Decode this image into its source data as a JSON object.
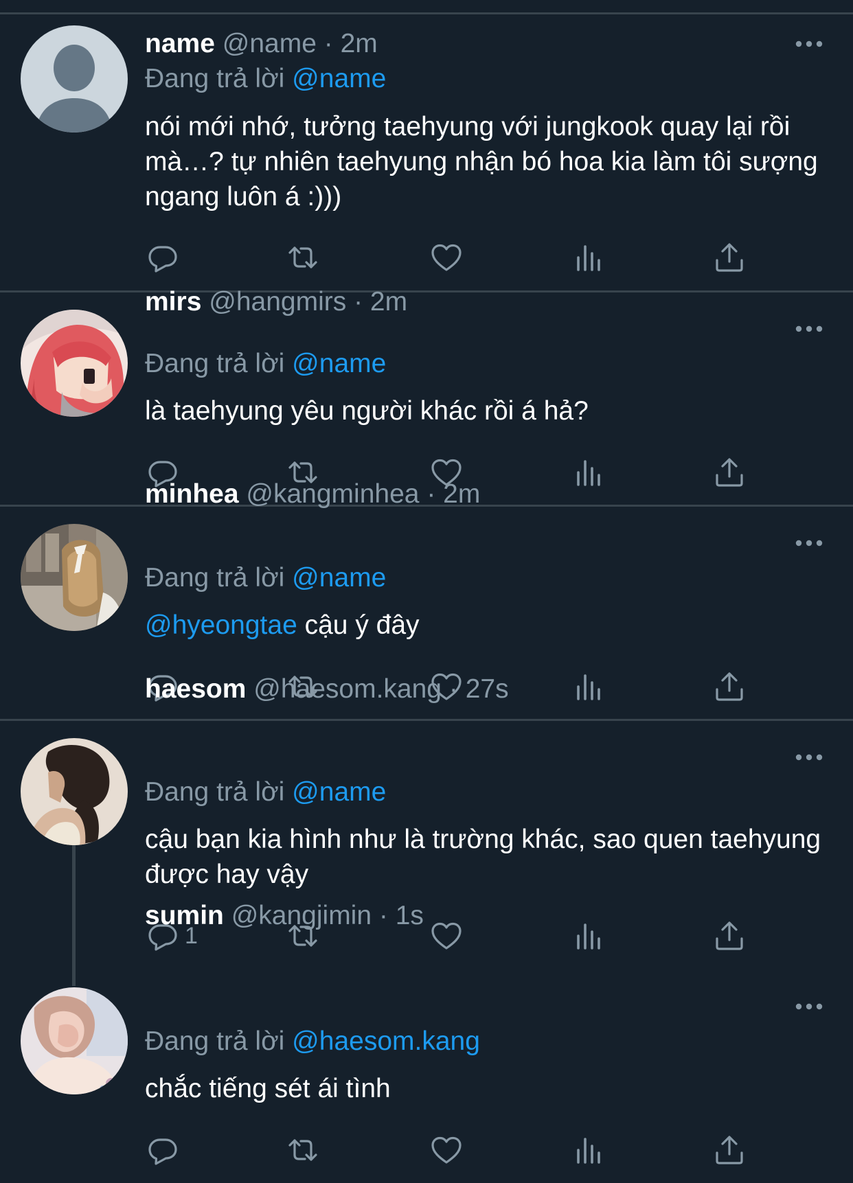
{
  "tweets": [
    {
      "display_name": "name",
      "handle": "@name",
      "time": "2m",
      "replying_label": "Đang trả lời",
      "reply_to": "@name",
      "text": "nói mới nhớ, tưởng taehyung với jungkook quay lại rồi mà…? tự nhiên taehyung nhận bó hoa kia làm tôi sượng ngang luôn á :)))",
      "reply_count": ""
    },
    {
      "display_name": "mirs",
      "handle": "@hangmirs",
      "time": "2m",
      "replying_label": "Đang trả lời",
      "reply_to": "@name",
      "text": "là taehyung yêu người khác rồi á hả?",
      "reply_count": ""
    },
    {
      "display_name": "minhea",
      "handle": "@kangminhea",
      "time": "2m",
      "replying_label": "Đang trả lời",
      "reply_to": "@name",
      "text_mention": "@hyeongtae",
      "text": " cậu ý đây",
      "reply_count": ""
    },
    {
      "display_name": "haesom",
      "handle": "@haesom.kang",
      "time": "27s",
      "replying_label": "Đang trả lời",
      "reply_to": "@name",
      "text": "cậu bạn kia hình như là trường khác, sao quen taehyung được hay vậy",
      "reply_count": "1"
    },
    {
      "display_name": "sumin",
      "handle": "@kangjimin",
      "time": "1s",
      "replying_label": "Đang trả lời",
      "reply_to": "@haesom.kang",
      "text": "chắc tiếng sét ái tình",
      "reply_count": ""
    }
  ],
  "icons": {
    "reply": "reply-icon",
    "retweet": "retweet-icon",
    "like": "heart-icon",
    "views": "analytics-icon",
    "share": "share-icon",
    "more": "more-icon"
  },
  "colors": {
    "background": "#15202b",
    "secondary_text": "#8899a6",
    "mention": "#1d9bf0",
    "divider": "#38444d"
  }
}
